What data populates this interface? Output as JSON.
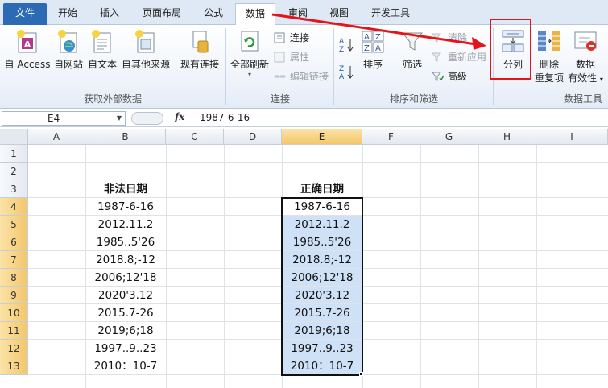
{
  "tabs": [
    {
      "label": "文件"
    },
    {
      "label": "开始"
    },
    {
      "label": "插入"
    },
    {
      "label": "页面布局"
    },
    {
      "label": "公式"
    },
    {
      "label": "数据"
    },
    {
      "label": "审阅"
    },
    {
      "label": "视图"
    },
    {
      "label": "开发工具"
    }
  ],
  "ribbon": {
    "get_external": {
      "label": "获取外部数据",
      "buttons": [
        "自 Access",
        "自网站",
        "自文本",
        "自其他来源",
        "现有连接"
      ]
    },
    "connections": {
      "label": "连接",
      "refresh_all": "全部刷新",
      "links": [
        "连接",
        "属性",
        "编辑链接"
      ]
    },
    "sort_filter": {
      "label": "排序和筛选",
      "sort": "排序",
      "filter": "筛选",
      "clear": "清除",
      "reapply": "重新应用",
      "advanced": "高级"
    },
    "data_tools": {
      "label": "数据工具",
      "split": "分列",
      "remove_dup_1": "删除",
      "remove_dup_2": "重复项",
      "validation_1": "数据",
      "validation_2": "有效性"
    }
  },
  "formula_bar": {
    "name_box": "E4",
    "fx": "fx",
    "formula": "1987-6-16"
  },
  "columns": [
    "A",
    "B",
    "C",
    "D",
    "E",
    "F",
    "G",
    "H",
    "I"
  ],
  "rows": [
    "1",
    "2",
    "3",
    "4",
    "5",
    "6",
    "7",
    "8",
    "9",
    "10",
    "11",
    "12",
    "13"
  ],
  "cells": {
    "B3": "非法日期",
    "E3": "正确日期",
    "B_values": [
      "1987-6-16",
      "2012.11.2",
      "1985..5'26",
      "2018.8;-12",
      "2006;12'18",
      "2020'3.12",
      "2015.7-26",
      "2019;6;18",
      "1997..9..23",
      "2010：10-7"
    ],
    "E_values": [
      "1987-6-16",
      "2012.11.2",
      "1985..5'26",
      "2018.8;-12",
      "2006;12'18",
      "2020'3.12",
      "2015.7-26",
      "2019;6;18",
      "1997..9..23",
      "2010：10-7"
    ]
  },
  "colors": {
    "accent_file_tab": "#2c6bb3",
    "selection_fill": "#cfe1f6",
    "annotation_red": "#e5141b",
    "header_selected": "#f3c76b"
  }
}
